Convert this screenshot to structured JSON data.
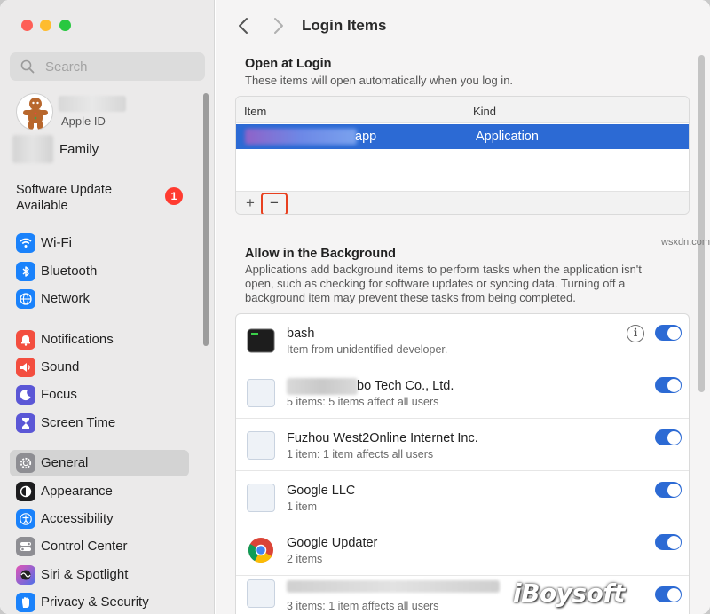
{
  "window": {
    "title": "Login Items"
  },
  "sidebar": {
    "search_placeholder": "Search",
    "account": {
      "apple_id_label": "Apple ID",
      "family_label": "Family"
    },
    "software_update": {
      "label": "Software Update Available",
      "badge": "1"
    },
    "items": [
      {
        "label": "Wi-Fi",
        "icon": "wifi-icon",
        "color": "#1a82fb"
      },
      {
        "label": "Bluetooth",
        "icon": "bluetooth-icon",
        "color": "#1a82fb"
      },
      {
        "label": "Network",
        "icon": "globe-icon",
        "color": "#1a82fb"
      },
      {
        "label": "Notifications",
        "icon": "bell-icon",
        "color": "#f34e3f"
      },
      {
        "label": "Sound",
        "icon": "speaker-icon",
        "color": "#f34e3f"
      },
      {
        "label": "Focus",
        "icon": "moon-icon",
        "color": "#5b57d6"
      },
      {
        "label": "Screen Time",
        "icon": "hourglass-icon",
        "color": "#5b57d6"
      },
      {
        "label": "General",
        "icon": "gear-icon",
        "color": "#8e8e93",
        "selected": true
      },
      {
        "label": "Appearance",
        "icon": "appearance-icon",
        "color": "#1c1c1e"
      },
      {
        "label": "Accessibility",
        "icon": "accessibility-icon",
        "color": "#1a82fb"
      },
      {
        "label": "Control Center",
        "icon": "control-center-icon",
        "color": "#8e8e93"
      },
      {
        "label": "Siri & Spotlight",
        "icon": "siri-icon",
        "color": "#b04fd6"
      },
      {
        "label": "Privacy & Security",
        "icon": "hand-icon",
        "color": "#1a82fb"
      }
    ]
  },
  "main": {
    "title": "Login Items",
    "open_at_login": {
      "title": "Open at Login",
      "subtitle": "These items will open automatically when you log in.",
      "columns": {
        "item": "Item",
        "kind": "Kind"
      },
      "rows": [
        {
          "item": "app",
          "kind": "Application"
        }
      ],
      "add_label": "+",
      "remove_label": "−"
    },
    "background": {
      "title": "Allow in the Background",
      "description": "Applications add background items to perform tasks when the application isn't open, such as checking for software updates or syncing data. Turning off a background item may prevent these tasks from being completed.",
      "items": [
        {
          "name": "bash",
          "detail": "Item from unidentified developer.",
          "icon": "terminal-icon",
          "info": "i",
          "enabled": true
        },
        {
          "name": "bo Tech Co., Ltd.",
          "detail": "5 items: 5 items affect all users",
          "icon": "generic-app-icon",
          "enabled": true
        },
        {
          "name": "Fuzhou West2Online Internet Inc.",
          "detail": "1 item: 1 item affects all users",
          "icon": "generic-app-icon",
          "enabled": true
        },
        {
          "name": "Google LLC",
          "detail": "1 item",
          "icon": "generic-app-icon",
          "enabled": true
        },
        {
          "name": "Google Updater",
          "detail": "2 items",
          "icon": "chrome-icon",
          "enabled": true
        },
        {
          "name": "",
          "detail": "3 items: 1 item affects all users",
          "icon": "generic-app-icon",
          "enabled": true
        }
      ]
    }
  },
  "watermark": {
    "brand": "iBoysoft",
    "site": "wsxdn.com"
  }
}
